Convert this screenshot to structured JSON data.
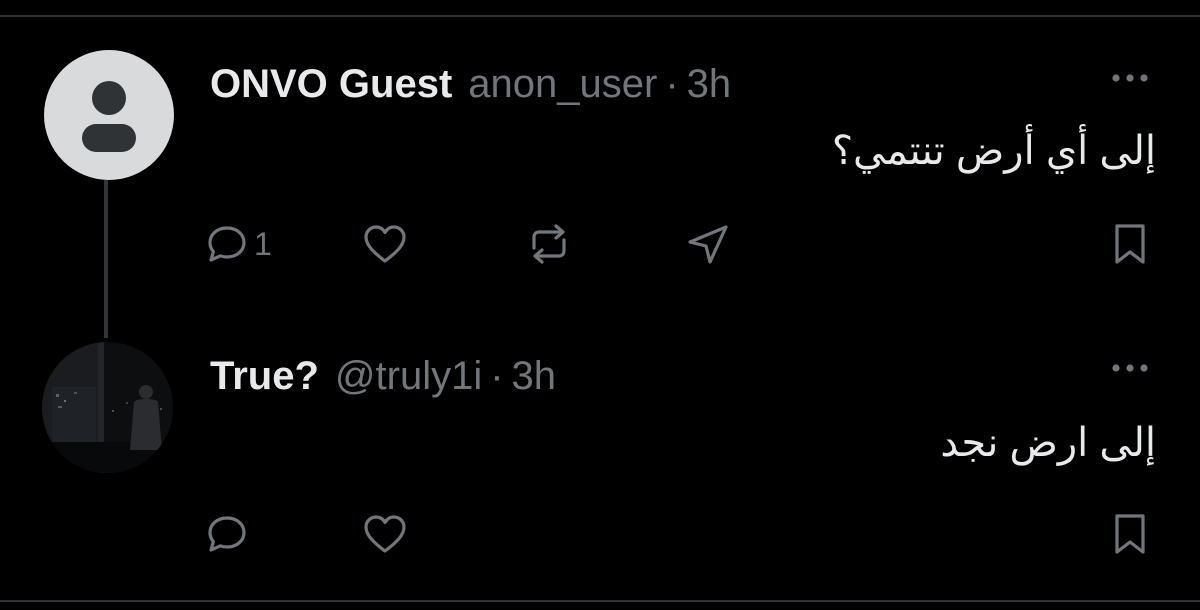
{
  "colors": {
    "background": "#000000",
    "text": "#e7e9ea",
    "muted": "#71767b",
    "divider": "#2f3336"
  },
  "posts": [
    {
      "display_name": "ONVO Guest",
      "handle": "anon_user",
      "separator": "·",
      "time": "3h",
      "text": "إلى أي أرض تنتمي؟",
      "avatar": "default-avatar-icon",
      "reply_count": "1",
      "actions": [
        "reply-icon",
        "like-icon",
        "repost-icon",
        "share-icon",
        "bookmark-icon"
      ]
    },
    {
      "display_name": "True?",
      "handle": "@truly1i",
      "separator": "·",
      "time": "3h",
      "text": "إلى ارض نجد",
      "avatar": "profile-photo",
      "actions": [
        "reply-icon",
        "like-icon",
        "bookmark-icon"
      ]
    }
  ]
}
